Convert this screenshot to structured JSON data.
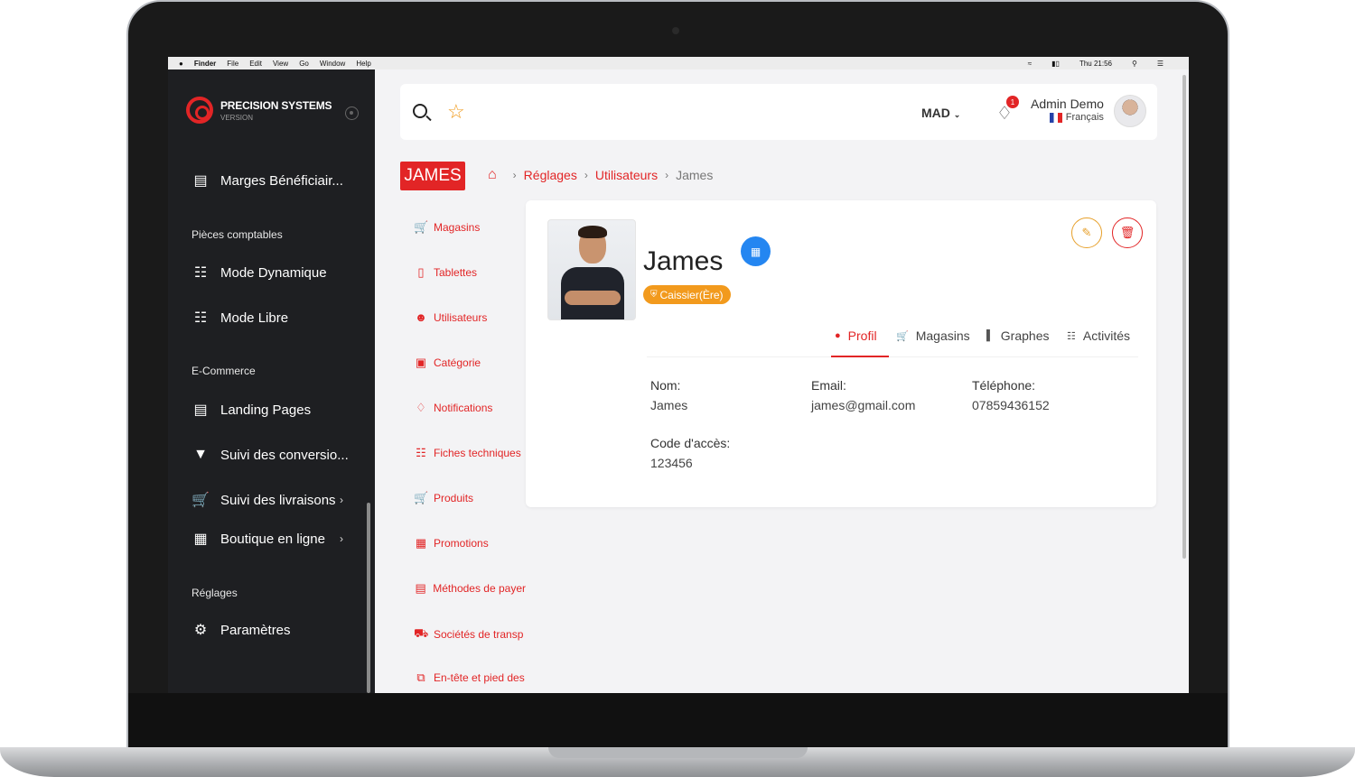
{
  "menubar": {
    "app": "Finder",
    "items": [
      "File",
      "Edit",
      "View",
      "Go",
      "Window",
      "Help"
    ],
    "clock": "Thu 21:56"
  },
  "sidebar": {
    "brand": {
      "name": "PRECISION SYSTEMS",
      "version": "VERSION"
    },
    "items": [
      {
        "label": "Marges Bénéficiair...",
        "icon": "dollar-card-icon"
      },
      {
        "label": "Mode Dynamique",
        "icon": "document-icon"
      },
      {
        "label": "Mode Libre",
        "icon": "document-icon"
      },
      {
        "label": "Landing Pages",
        "icon": "card-icon"
      },
      {
        "label": "Suivi des conversio...",
        "icon": "funnel-icon"
      },
      {
        "label": "Suivi des livraisons",
        "icon": "cart-icon"
      },
      {
        "label": "Boutique en ligne",
        "icon": "store-icon"
      },
      {
        "label": "Paramètres",
        "icon": "gears-icon"
      }
    ],
    "sections": [
      "Pièces comptables",
      "E-Commerce",
      "Réglages"
    ]
  },
  "topbar": {
    "currency": "MAD",
    "notification_count": "1",
    "user_name": "Admin Demo",
    "language": "Français"
  },
  "breadcrumb": {
    "tag": "JAMES",
    "items": [
      "Réglages",
      "Utilisateurs"
    ],
    "current": "James"
  },
  "submenu": [
    {
      "label": "Magasins",
      "icon": "cart-icon"
    },
    {
      "label": "Tablettes",
      "icon": "tablet-icon"
    },
    {
      "label": "Utilisateurs",
      "icon": "users-icon"
    },
    {
      "label": "Catégorie",
      "icon": "category-icon"
    },
    {
      "label": "Notifications",
      "icon": "bell-icon"
    },
    {
      "label": "Fiches techniques",
      "icon": "file-icon"
    },
    {
      "label": "Produits",
      "icon": "cart-icon"
    },
    {
      "label": "Promotions",
      "icon": "gift-icon"
    },
    {
      "label": "Méthodes de payer",
      "icon": "credit-card-icon"
    },
    {
      "label": "Sociétés de transp",
      "icon": "truck-icon"
    },
    {
      "label": "En-tête et pied des",
      "icon": "copy-icon"
    }
  ],
  "profile": {
    "name": "James",
    "role": "Caissier(Ère)",
    "tabs": [
      "Profil",
      "Magasins",
      "Graphes",
      "Activités"
    ],
    "active_tab": "Profil",
    "fields": {
      "name_label": "Nom:",
      "name_value": "James",
      "email_label": "Email:",
      "email_value": "james@gmail.com",
      "phone_label": "Téléphone:",
      "phone_value": "07859436152",
      "code_label": "Code d'accès:",
      "code_value": "123456"
    }
  },
  "colors": {
    "accent": "#e22526",
    "warning": "#f29a1d",
    "info": "#2486f1",
    "sidebar": "#1e1f22"
  }
}
